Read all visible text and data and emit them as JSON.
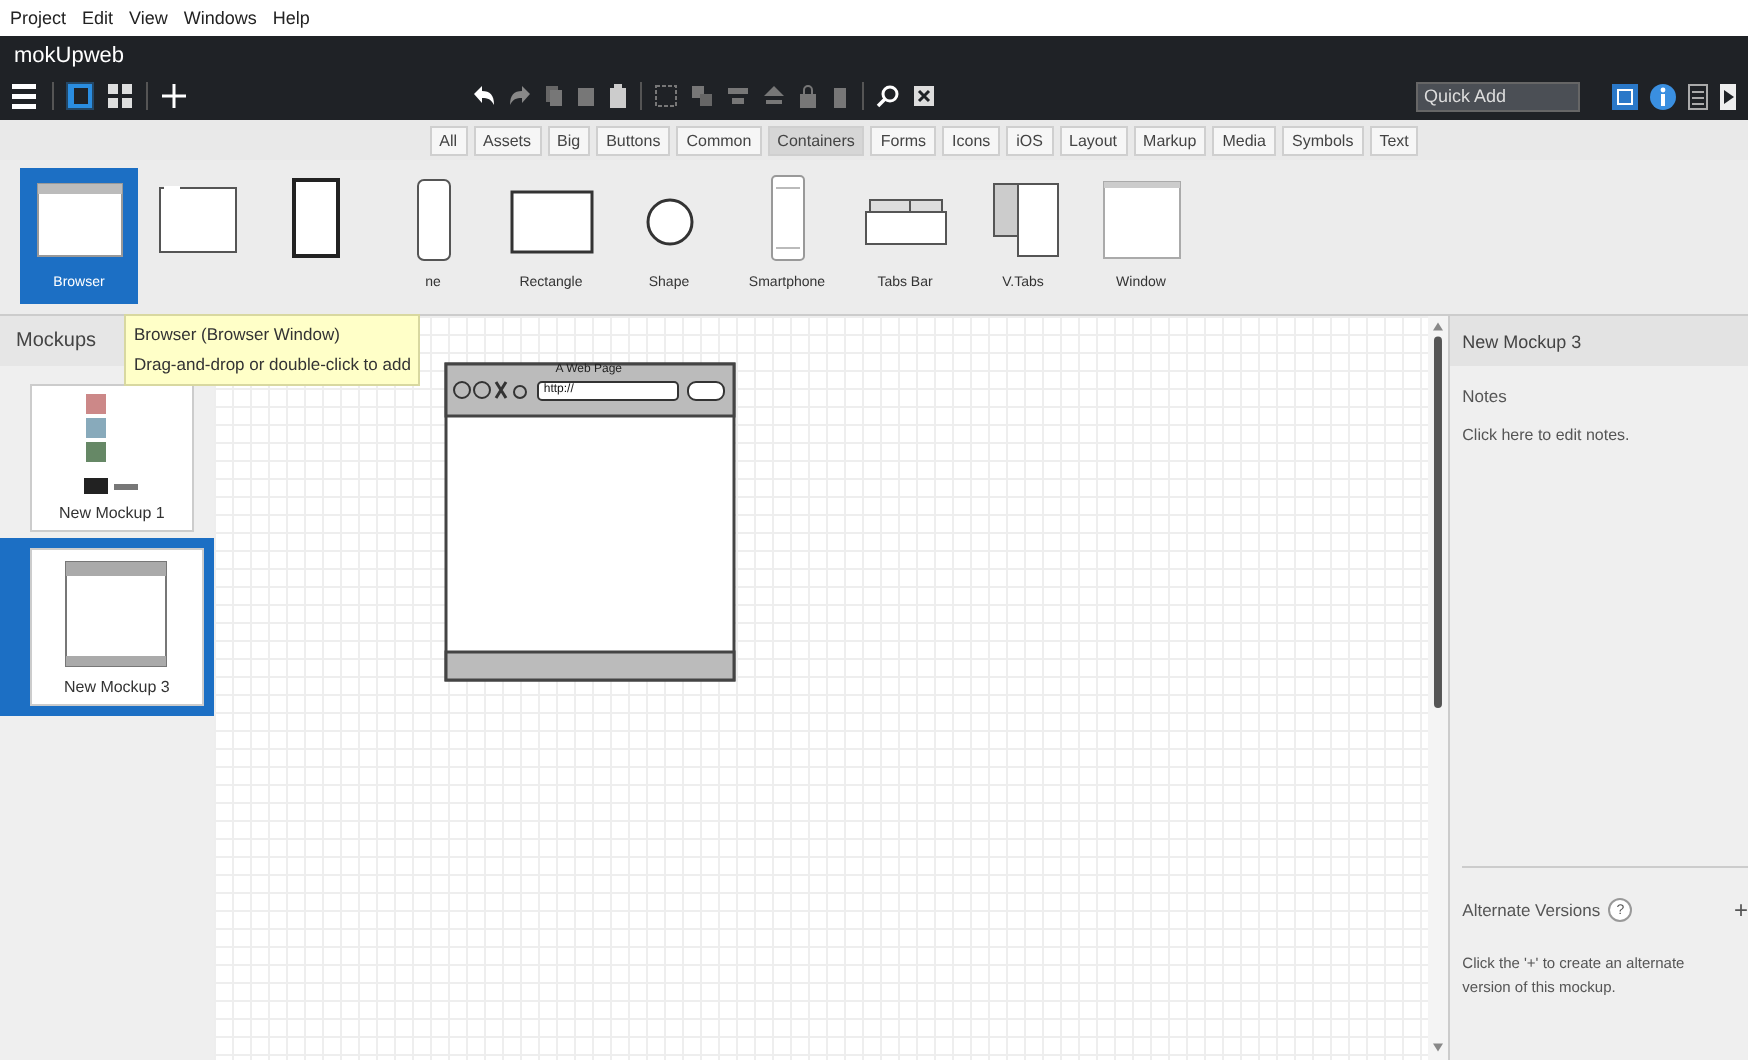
{
  "menu_bar": [
    "Project",
    "Edit",
    "View",
    "Windows",
    "Help"
  ],
  "window": {
    "title": "mokUpweb"
  },
  "view_toggles": [
    {
      "kind": "single",
      "selected": true
    },
    {
      "kind": "grid",
      "selected": false
    }
  ],
  "quick_add": {
    "placeholder": "Quick Add"
  },
  "categories": [
    {
      "label": "All",
      "selected": false
    },
    {
      "label": "Assets",
      "selected": false
    },
    {
      "label": "Big",
      "selected": false
    },
    {
      "label": "Buttons",
      "selected": false
    },
    {
      "label": "Common",
      "selected": false
    },
    {
      "label": "Containers",
      "selected": true
    },
    {
      "label": "Forms",
      "selected": false
    },
    {
      "label": "Icons",
      "selected": false
    },
    {
      "label": "iOS",
      "selected": false
    },
    {
      "label": "Layout",
      "selected": false
    },
    {
      "label": "Markup",
      "selected": false
    },
    {
      "label": "Media",
      "selected": false
    },
    {
      "label": "Symbols",
      "selected": false
    },
    {
      "label": "Text",
      "selected": false
    }
  ],
  "palette": [
    {
      "kind": "browser",
      "label": "Browser",
      "selected": true
    },
    {
      "kind": "page",
      "selected": false
    },
    {
      "kind": "tablet",
      "selected": false
    },
    {
      "kind": "phone",
      "label": "ne",
      "selected": false
    },
    {
      "kind": "rectangle",
      "label": "Rectangle",
      "selected": false
    },
    {
      "kind": "circle",
      "label": "Shape",
      "selected": false
    },
    {
      "kind": "smartphone",
      "label": "Smartphone",
      "selected": false
    },
    {
      "kind": "tabsbar",
      "label": "Tabs Bar",
      "selected": false
    },
    {
      "kind": "vtabs",
      "label": "V.Tabs",
      "selected": false
    },
    {
      "kind": "window",
      "label": "Window",
      "selected": false
    }
  ],
  "tooltip": {
    "title": "Browser (Browser Window)",
    "hint": "Drag-and-drop or double-click to add"
  },
  "mockups": {
    "title": "Mockups",
    "items": [
      {
        "kind": "media",
        "name": "New Mockup 1",
        "selected": false
      },
      {
        "kind": "browser",
        "name": "New Mockup 3",
        "selected": true
      }
    ]
  },
  "canvas": {
    "browser_title": "A Web Page",
    "url": "http://"
  },
  "properties": {
    "title": "New Mockup 3",
    "notes_label": "Notes",
    "notes_hint": "Click here to edit notes.",
    "alt_title": "Alternate Versions",
    "alt_help": "?",
    "alt_add": "+",
    "alt_hint": "Click the '+' to create an alternate version of this mockup."
  }
}
